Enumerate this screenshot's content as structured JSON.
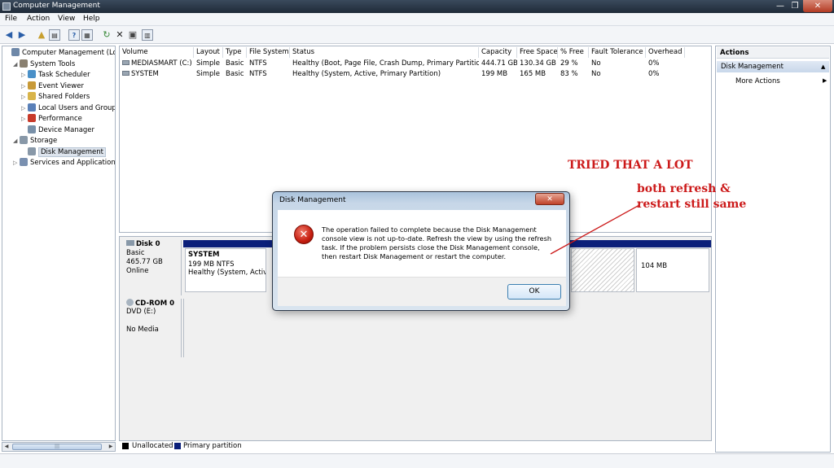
{
  "window": {
    "title": "Computer Management",
    "min_glyph": "—",
    "max_glyph": "❐",
    "close_glyph": "✕"
  },
  "menu": [
    "File",
    "Action",
    "View",
    "Help"
  ],
  "toolbar": [
    "back-arrow",
    "forward-arrow",
    "up-folder",
    "show-hide-tree",
    "help",
    "properties",
    "refresh",
    "delete",
    "export",
    "view-options"
  ],
  "tree": {
    "items": [
      {
        "label": "Computer Management (Local",
        "depth": 0,
        "exp": "",
        "icon": "computer-icon",
        "color": "#6e88a8"
      },
      {
        "label": "System Tools",
        "depth": 1,
        "exp": "◢",
        "icon": "tools-icon",
        "color": "#8a8070"
      },
      {
        "label": "Task Scheduler",
        "depth": 2,
        "exp": "▷",
        "icon": "clock-icon",
        "color": "#4a90c8"
      },
      {
        "label": "Event Viewer",
        "depth": 2,
        "exp": "▷",
        "icon": "event-icon",
        "color": "#c89a38"
      },
      {
        "label": "Shared Folders",
        "depth": 2,
        "exp": "▷",
        "icon": "folder-icon",
        "color": "#d8b44a"
      },
      {
        "label": "Local Users and Groups",
        "depth": 2,
        "exp": "▷",
        "icon": "users-icon",
        "color": "#5a80b8"
      },
      {
        "label": "Performance",
        "depth": 2,
        "exp": "▷",
        "icon": "performance-icon",
        "color": "#c83a2a"
      },
      {
        "label": "Device Manager",
        "depth": 2,
        "exp": "",
        "icon": "device-icon",
        "color": "#7890a8"
      },
      {
        "label": "Storage",
        "depth": 1,
        "exp": "◢",
        "icon": "storage-icon",
        "color": "#8898a8"
      },
      {
        "label": "Disk Management",
        "depth": 2,
        "exp": "",
        "icon": "disk-icon",
        "color": "#8898a8",
        "selected": true
      },
      {
        "label": "Services and Applications",
        "depth": 1,
        "exp": "▷",
        "icon": "services-icon",
        "color": "#7a90b0"
      }
    ]
  },
  "volumes": {
    "columns": [
      "Volume",
      "Layout",
      "Type",
      "File System",
      "Status",
      "Capacity",
      "Free Space",
      "% Free",
      "Fault Tolerance",
      "Overhead"
    ],
    "rows": [
      [
        "MEDIASMART (C:)",
        "Simple",
        "Basic",
        "NTFS",
        "Healthy (Boot, Page File, Crash Dump, Primary Partition)",
        "444.71 GB",
        "130.34 GB",
        "29 %",
        "No",
        "0%"
      ],
      [
        "SYSTEM",
        "Simple",
        "Basic",
        "NTFS",
        "Healthy (System, Active, Primary Partition)",
        "199 MB",
        "165 MB",
        "83 %",
        "No",
        "0%"
      ]
    ]
  },
  "disks": {
    "disk0": {
      "name": "Disk 0",
      "type": "Basic",
      "size": "465.77 GB",
      "state": "Online"
    },
    "system_part": {
      "name": "SYSTEM",
      "size": "199 MB NTFS",
      "status": "Healthy (System, Active"
    },
    "small_part": {
      "size": "104 MB"
    },
    "cdrom": {
      "name": "CD-ROM 0",
      "drive": "DVD (E:)",
      "media": "No Media"
    }
  },
  "legend": {
    "unallocated": "Unallocated",
    "primary": "Primary partition",
    "colors": {
      "unallocated": "#000000",
      "primary": "#0b1f7a"
    }
  },
  "actions": {
    "header": "Actions",
    "section": "Disk Management",
    "more": "More Actions",
    "collapse_glyph": "▲",
    "more_glyph": "▶"
  },
  "dialog": {
    "title": "Disk Management",
    "close_glyph": "✕",
    "message": "The operation failed to complete because the Disk Management console view is not up-to-date.  Refresh the view by using the refresh task. If the problem persists close the Disk Management console, then restart Disk Management or restart the computer.",
    "ok": "OK"
  },
  "annotations": {
    "line1": "TRIED THAT A LOT",
    "line2": "both refresh & restart still same",
    "color": "#cc1a1a"
  }
}
